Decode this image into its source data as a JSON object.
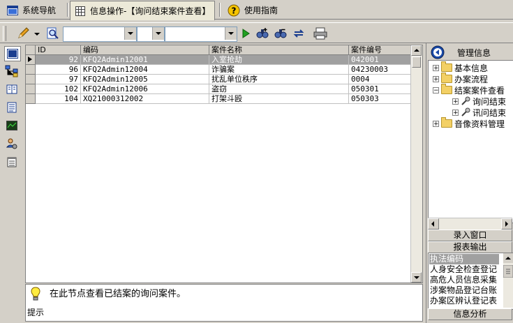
{
  "tabs": [
    {
      "label": "系统导航",
      "icon": "window-icon"
    },
    {
      "label": "信息操作-【询问结束案件查看】",
      "icon": "grid-icon",
      "active": true
    },
    {
      "label": "使用指南",
      "icon": "help-icon"
    }
  ],
  "toolbar": {
    "combo1_value": "",
    "combo2_value": "",
    "combo3_value": ""
  },
  "grid": {
    "columns": [
      "ID",
      "编码",
      "案件名称",
      "案件编号"
    ],
    "rows": [
      {
        "id": "92",
        "code": "KFQ2Admin12001",
        "name": "入室抢劫",
        "number": "042001"
      },
      {
        "id": "96",
        "code": "KFQ2Admin12004",
        "name": "诈骗案",
        "number": "04230003"
      },
      {
        "id": "97",
        "code": "KFQ2Admin12005",
        "name": "扰乱单位秩序",
        "number": "0004"
      },
      {
        "id": "102",
        "code": "KFQ2Admin12006",
        "name": "盗窃",
        "number": "050301"
      },
      {
        "id": "104",
        "code": "XQ21000312002",
        "name": "打架斗殴",
        "number": "050303"
      }
    ]
  },
  "hint": {
    "label": "提示",
    "text": "在此节点查看已结案的询问案件。"
  },
  "rightpanel": {
    "title": "管理信息",
    "tree": [
      {
        "label": "基本信息",
        "expander": "+"
      },
      {
        "label": "办案流程",
        "expander": "+"
      },
      {
        "label": "结案案件查看",
        "expander": "−"
      },
      {
        "label": "询问结束",
        "expander": "+"
      },
      {
        "label": "讯问结束",
        "expander": "+"
      },
      {
        "label": "音像资料管理",
        "expander": "+"
      }
    ],
    "bar1": "录入窗口",
    "bar2": "报表输出",
    "list": [
      "执法编码",
      "人身安全检查登记",
      "高危人员信息采集",
      "涉案物品登记台账",
      "办案区辨认登记表"
    ],
    "bar3": "信息分析"
  },
  "colors": {
    "selected_row": "#a0a0a0",
    "chrome": "#d4d0c8"
  }
}
